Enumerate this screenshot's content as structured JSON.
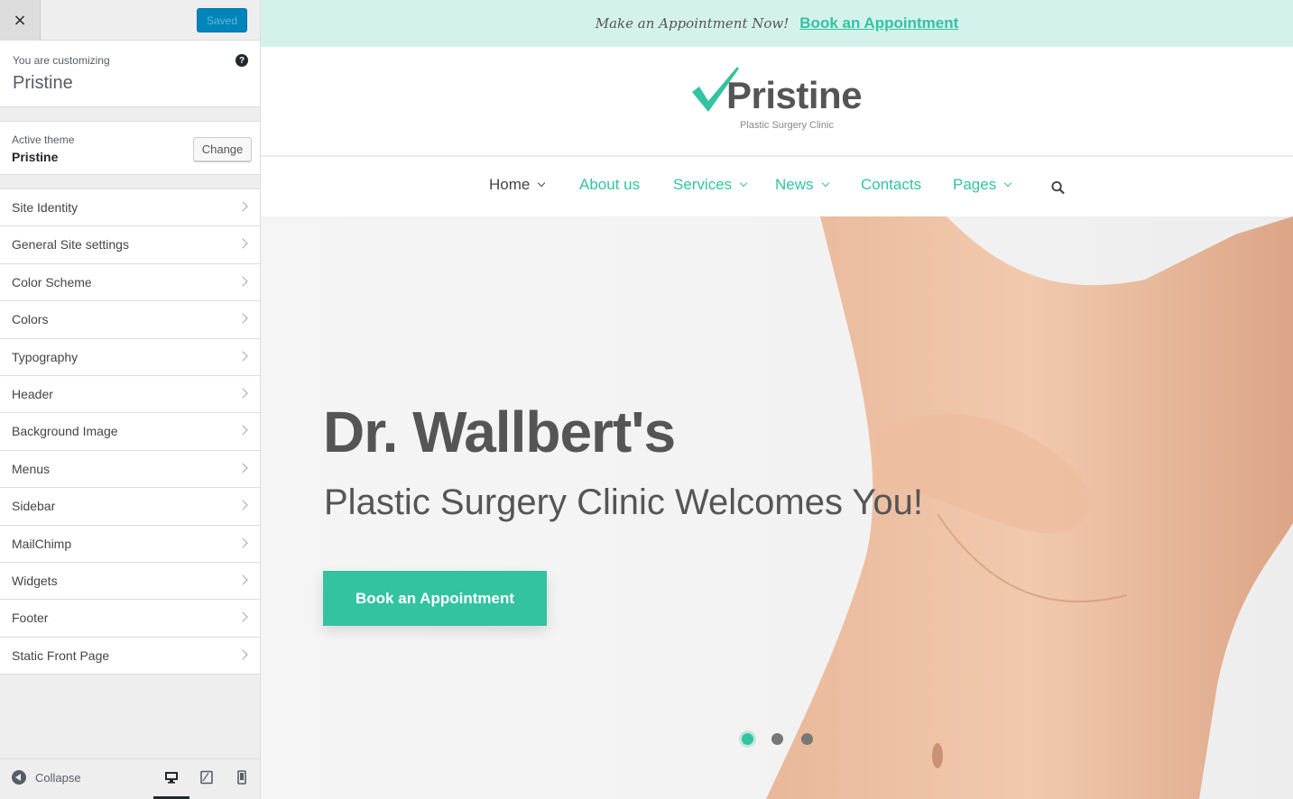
{
  "customizer": {
    "close_glyph": "×",
    "saved_label": "Saved",
    "customizing_label": "You are customizing",
    "site_title": "Pristine",
    "help_glyph": "?",
    "active_theme_label": "Active theme",
    "active_theme_name": "Pristine",
    "change_label": "Change",
    "sections": [
      {
        "label": "Site Identity"
      },
      {
        "label": "General Site settings"
      },
      {
        "label": "Color Scheme"
      },
      {
        "label": "Colors"
      },
      {
        "label": "Typography"
      },
      {
        "label": "Header"
      },
      {
        "label": "Background Image"
      },
      {
        "label": "Menus"
      },
      {
        "label": "Sidebar"
      },
      {
        "label": "MailChimp"
      },
      {
        "label": "Widgets"
      },
      {
        "label": "Footer"
      },
      {
        "label": "Static Front Page"
      }
    ],
    "collapse_label": "Collapse",
    "devices": {
      "active": "desktop",
      "items": [
        "desktop",
        "tablet",
        "mobile"
      ]
    }
  },
  "preview": {
    "topbar": {
      "text": "Make an Appointment Now!",
      "link": "Book an Appointment"
    },
    "logo": {
      "name": "Pristine",
      "tagline": "Plastic Surgery Clinic"
    },
    "nav": {
      "home": "Home",
      "about": "About us",
      "services": "Services",
      "news": "News",
      "contacts": "Contacts",
      "pages": "Pages"
    },
    "hero": {
      "title": "Dr. Wallbert's",
      "subtitle": "Plastic Surgery Clinic Welcomes You!",
      "button": "Book an Appointment",
      "slides": 3,
      "active_slide": 1
    }
  },
  "colors": {
    "accent": "#33c3a1",
    "topbar_bg": "#d4f2ec",
    "wp_blue": "#0085ba",
    "text_dark": "#555555"
  },
  "icons": [
    "close-icon",
    "help-icon",
    "chevron-right-icon",
    "collapse-icon",
    "desktop-icon",
    "tablet-icon",
    "mobile-icon",
    "checkmark-logo-icon",
    "chevron-down-icon",
    "search-icon"
  ]
}
